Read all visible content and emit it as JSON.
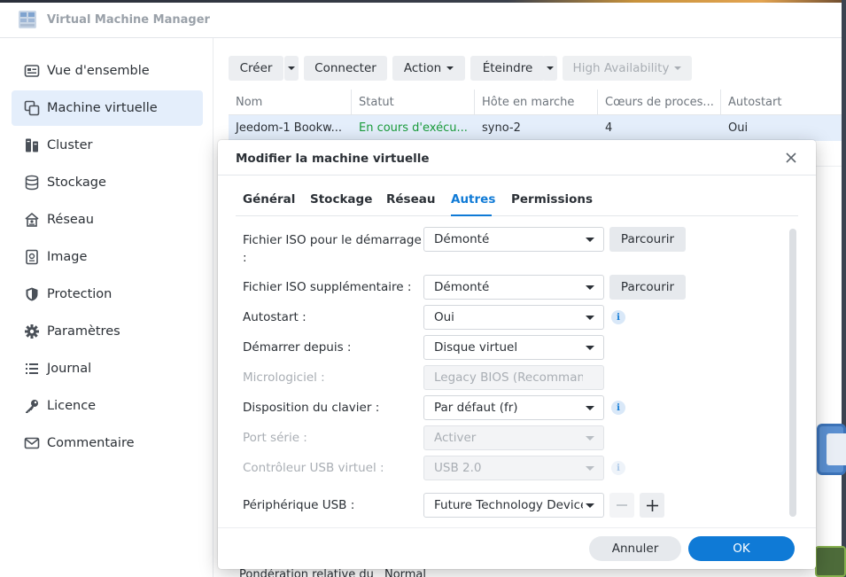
{
  "app": {
    "title": "Virtual Machine Manager"
  },
  "sidebar": {
    "items": [
      {
        "label": "Vue d'ensemble",
        "icon": "overview-icon"
      },
      {
        "label": "Machine virtuelle",
        "icon": "virtual-machine-icon",
        "active": true
      },
      {
        "label": "Cluster",
        "icon": "cluster-icon"
      },
      {
        "label": "Stockage",
        "icon": "storage-icon"
      },
      {
        "label": "Réseau",
        "icon": "network-icon"
      },
      {
        "label": "Image",
        "icon": "image-icon"
      },
      {
        "label": "Protection",
        "icon": "shield-icon"
      },
      {
        "label": "Paramètres",
        "icon": "gear-icon"
      },
      {
        "label": "Journal",
        "icon": "list-icon"
      },
      {
        "label": "Licence",
        "icon": "key-icon"
      },
      {
        "label": "Commentaire",
        "icon": "mail-icon"
      }
    ]
  },
  "toolbar": {
    "create": "Créer",
    "connect": "Connecter",
    "action": "Action",
    "shutdown": "Éteindre",
    "high_availability": "High Availability"
  },
  "grid": {
    "columns": [
      "Nom",
      "Statut",
      "Hôte en marche",
      "Cœurs de proces...",
      "Autostart"
    ],
    "rows": [
      [
        "Jeedom-1 Bookw...",
        "En cours d'exécu...",
        "syno-2",
        "4",
        "Oui"
      ]
    ],
    "status_color": "#1a9c3b"
  },
  "background_text": {
    "row_label": "Pondération relative du",
    "row_value": "Normal"
  },
  "dialog": {
    "title": "Modifier la machine virtuelle",
    "tabs": [
      "Général",
      "Stockage",
      "Réseau",
      "Autres",
      "Permissions"
    ],
    "active_tab": "Autres",
    "fields": {
      "boot_iso_label": "Fichier ISO pour le démarrage :",
      "boot_iso_value": "Démonté",
      "extra_iso_label": "Fichier ISO supplémentaire :",
      "extra_iso_value": "Démonté",
      "browse_label": "Parcourir",
      "autostart_label": "Autostart :",
      "autostart_value": "Oui",
      "boot_from_label": "Démarrer depuis :",
      "boot_from_value": "Disque virtuel",
      "firmware_label": "Micrologiciel :",
      "firmware_value": "Legacy BIOS (Recomman",
      "keyboard_label": "Disposition du clavier :",
      "keyboard_value": "Par défaut (fr)",
      "serial_label": "Port série :",
      "serial_value": "Activer",
      "usb_ctrl_label": "Contrôleur USB virtuel :",
      "usb_ctrl_value": "USB 2.0",
      "usb_dev_label": "Périphérique USB :",
      "usb_dev_value": "Future Technology Device"
    },
    "cancel_label": "Annuler",
    "ok_label": "OK",
    "accent_color": "#0f7ad6"
  }
}
